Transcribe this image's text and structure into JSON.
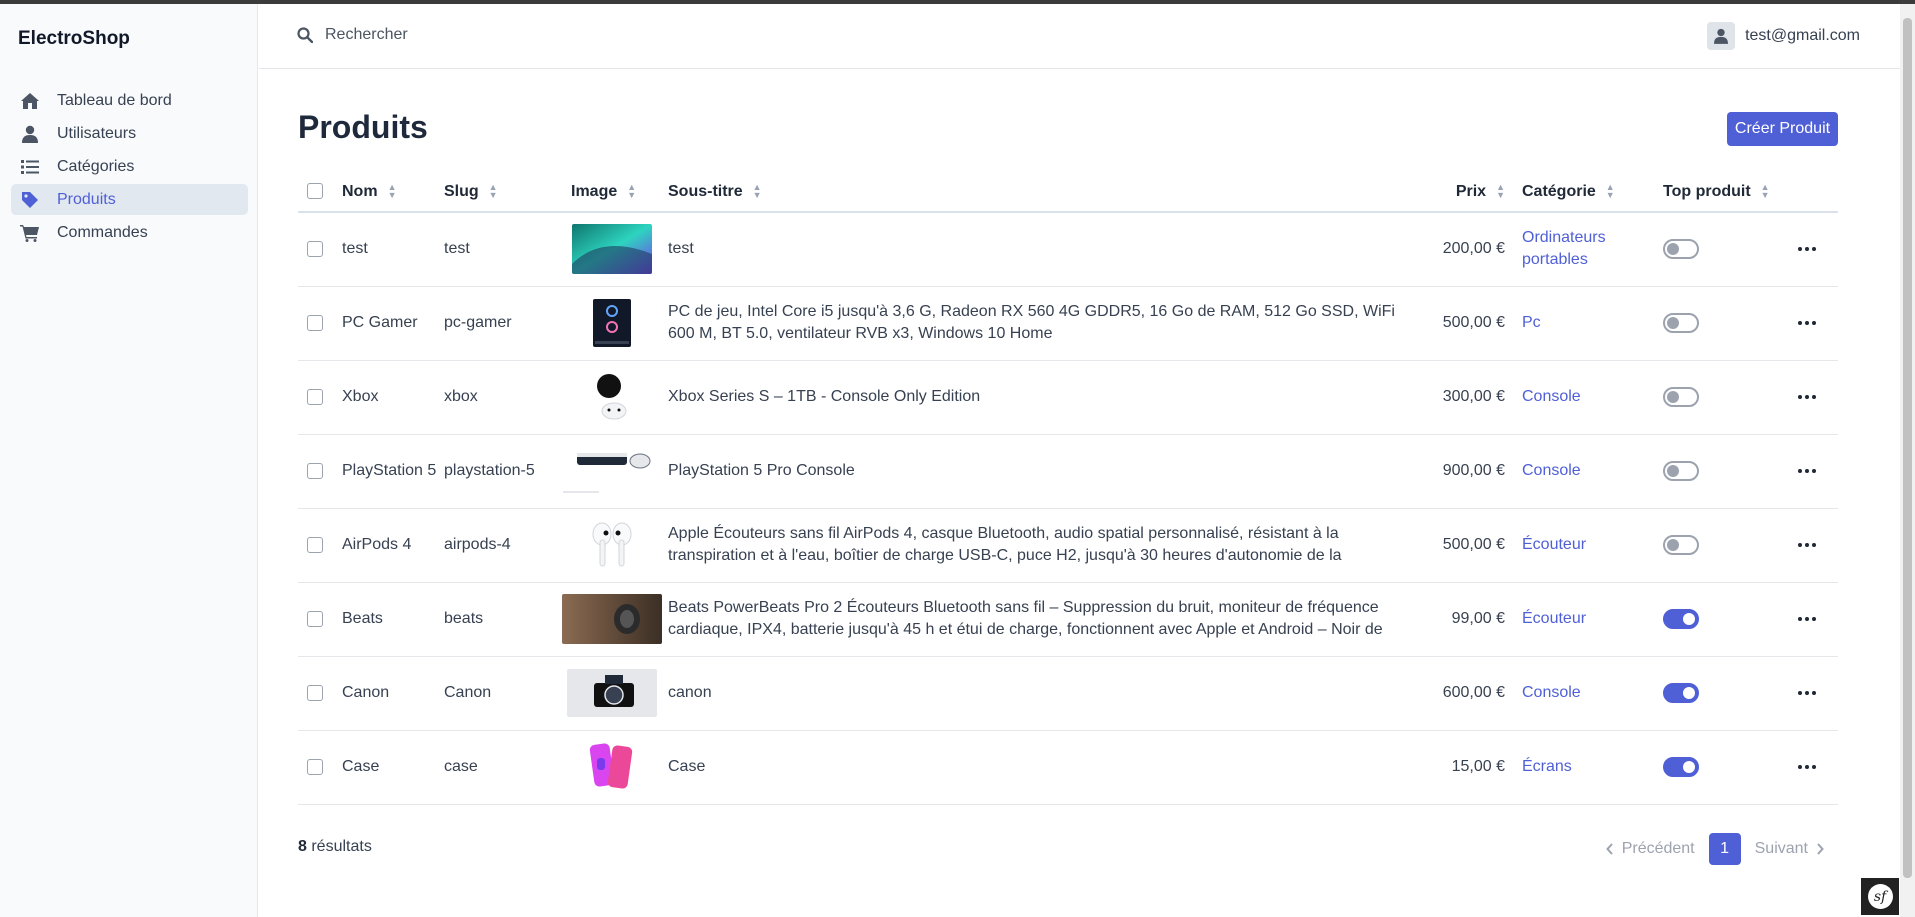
{
  "app": {
    "brand": "ElectroShop"
  },
  "sidebar": {
    "items": [
      {
        "label": "Tableau de bord",
        "icon": "home-icon",
        "active": false
      },
      {
        "label": "Utilisateurs",
        "icon": "user-icon",
        "active": false
      },
      {
        "label": "Catégories",
        "icon": "list-icon",
        "active": false
      },
      {
        "label": "Produits",
        "icon": "tag-icon",
        "active": true
      },
      {
        "label": "Commandes",
        "icon": "cart-icon",
        "active": false
      }
    ]
  },
  "header": {
    "search_placeholder": "Rechercher",
    "user_email": "test@gmail.com"
  },
  "main": {
    "title": "Produits",
    "create_button": "Créer Produit",
    "columns": {
      "name": "Nom",
      "slug": "Slug",
      "image": "Image",
      "subtitle": "Sous-titre",
      "price": "Prix",
      "category": "Catégorie",
      "top": "Top produit"
    },
    "rows": [
      {
        "name": "test",
        "slug": "test",
        "subtitle": "test",
        "price": "200,00 €",
        "category": "Ordinateurs portables",
        "top": false
      },
      {
        "name": "PC Gamer",
        "slug": "pc-gamer",
        "subtitle": "PC de jeu, Intel Core i5 jusqu'à 3,6 G, Radeon RX 560 4G GDDR5, 16 Go de RAM, 512 Go SSD, WiFi 600 M, BT 5.0, ventilateur RVB x3, Windows 10 Home",
        "price": "500,00 €",
        "category": "Pc",
        "top": false
      },
      {
        "name": "Xbox",
        "slug": "xbox",
        "subtitle": "Xbox Series S – 1TB - Console Only Edition",
        "price": "300,00 €",
        "category": "Console",
        "top": false
      },
      {
        "name": "PlayStation 5",
        "slug": "playstation-5",
        "subtitle": "PlayStation 5 Pro Console",
        "price": "900,00 €",
        "category": "Console",
        "top": false
      },
      {
        "name": "AirPods 4",
        "slug": "airpods-4",
        "subtitle": "Apple Écouteurs sans fil AirPods 4, casque Bluetooth, audio spatial personnalisé, résistant à la transpiration et à l'eau, boîtier de charge USB-C, puce H2, jusqu'à 30 heures d'autonomie de la",
        "price": "500,00 €",
        "category": "Écouteur",
        "top": false
      },
      {
        "name": "Beats",
        "slug": "beats",
        "subtitle": "Beats PowerBeats Pro 2 Écouteurs Bluetooth sans fil – Suppression du bruit, moniteur de fréquence cardiaque, IPX4, batterie jusqu'à 45 h et étui de charge, fonctionnent avec Apple et Android – Noir de",
        "price": "99,00 €",
        "category": "Écouteur",
        "top": true
      },
      {
        "name": "Canon",
        "slug": "Canon",
        "subtitle": "canon",
        "price": "600,00 €",
        "category": "Console",
        "top": true
      },
      {
        "name": "Case",
        "slug": "case",
        "subtitle": "Case",
        "price": "15,00 €",
        "category": "Écrans",
        "top": true
      }
    ]
  },
  "footer": {
    "results_count": "8",
    "results_label": " résultats",
    "prev": "Précédent",
    "page": "1",
    "next": "Suivant"
  },
  "colors": {
    "accent": "#4f5fd6",
    "sidebar_bg": "#f8fafc",
    "title": "#1e293b"
  }
}
